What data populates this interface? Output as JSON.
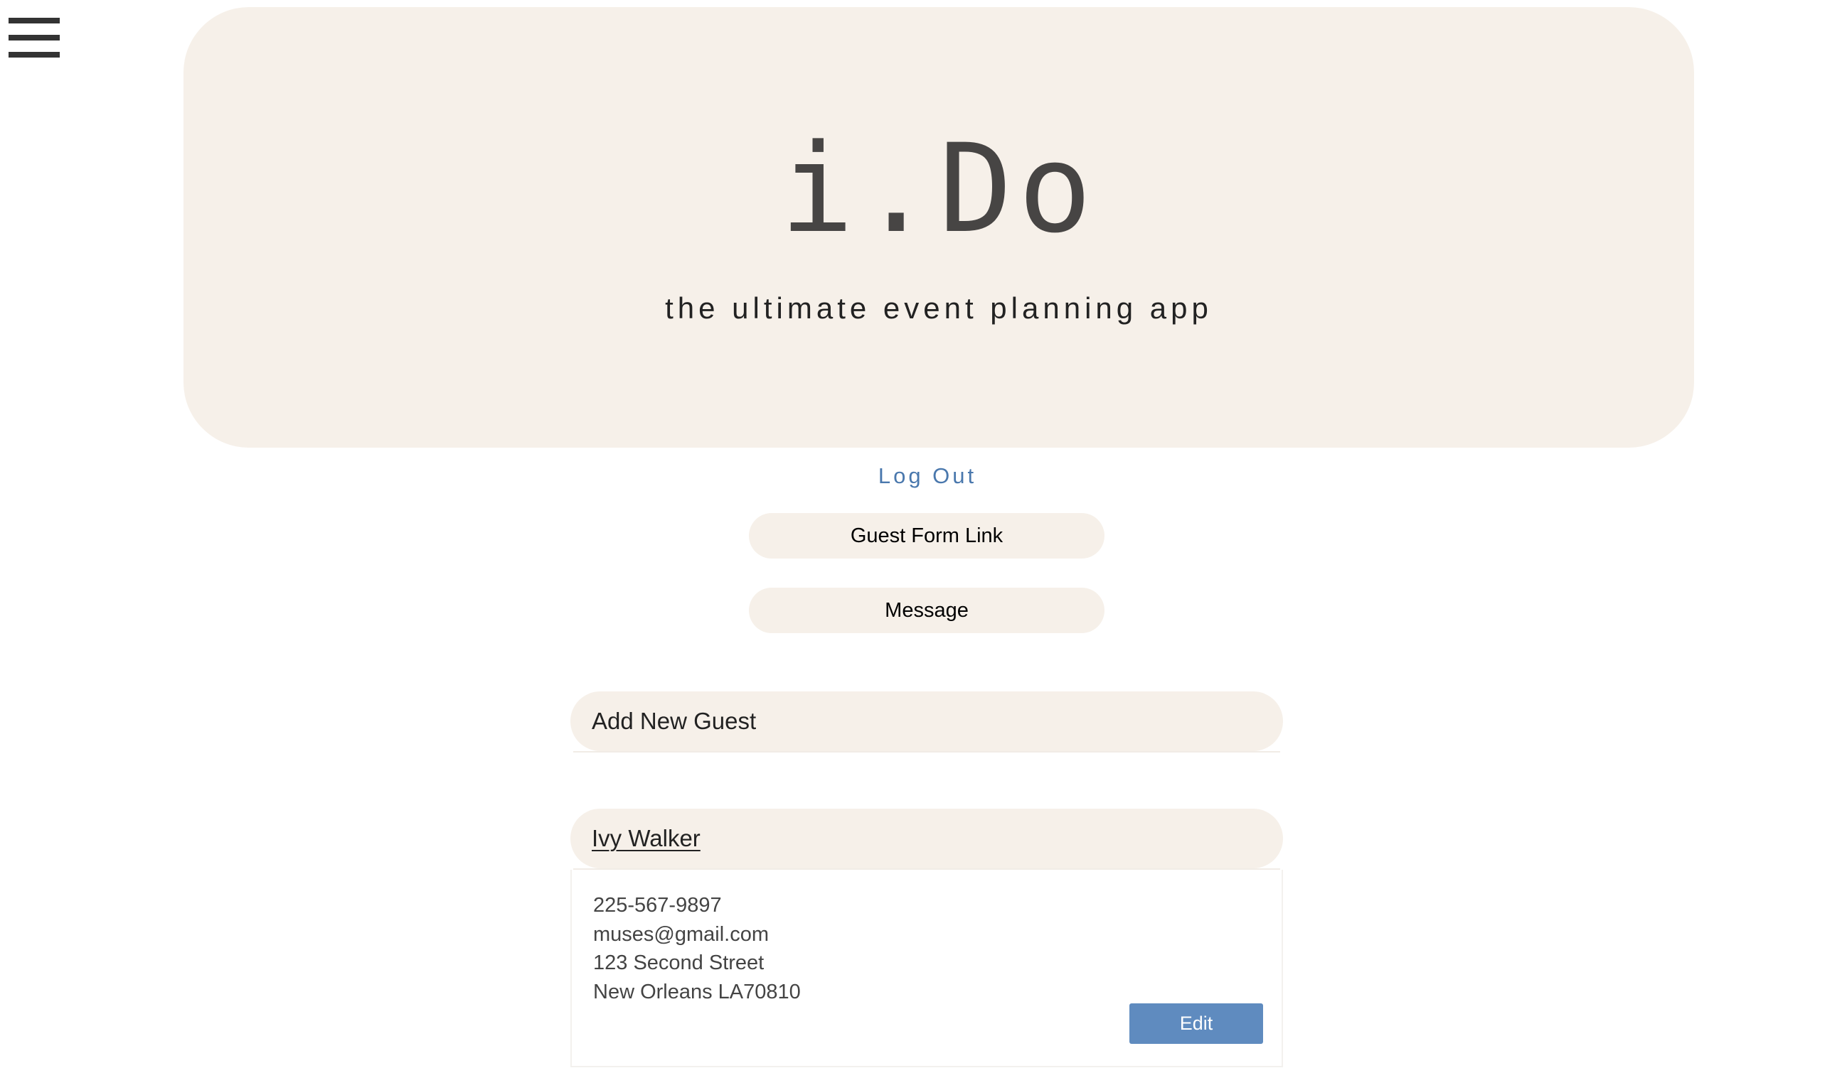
{
  "menu": {
    "icon": "hamburger-menu-icon"
  },
  "header": {
    "logo": "i.Do",
    "tagline": "the ultimate event planning app"
  },
  "nav": {
    "logout_label": "Log Out"
  },
  "actions": {
    "guest_form_link_label": "Guest Form Link",
    "message_label": "Message"
  },
  "add_guest": {
    "title": "Add New Guest"
  },
  "guest": {
    "name": "Ivy Walker",
    "phone": "225-567-9897",
    "email": "muses@gmail.com",
    "street": "123 Second Street",
    "city_state_zip": "New Orleans LA70810",
    "edit_label": "Edit"
  },
  "colors": {
    "panel_bg": "#f6f0e9",
    "accent_blue": "#5f8bbf",
    "link_blue": "#4a78ad"
  }
}
